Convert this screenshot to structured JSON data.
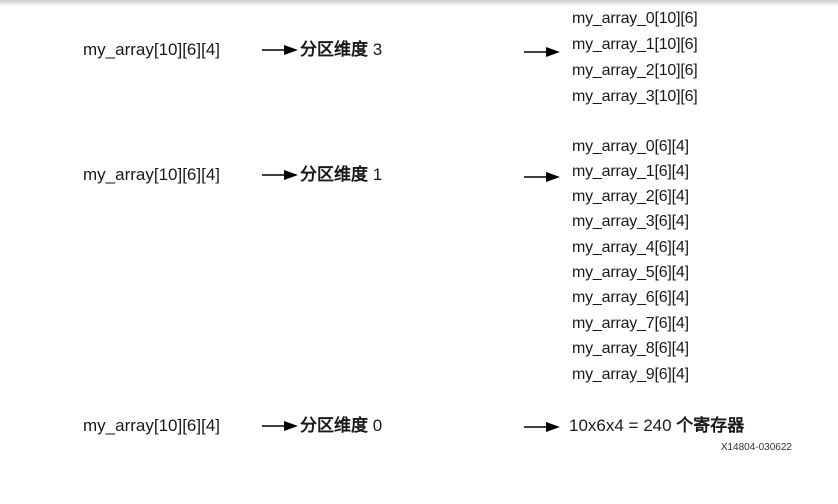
{
  "rows": [
    {
      "source": "my_array[10][6][4]",
      "label": "分区维度",
      "dim": "3",
      "outputs": [
        "my_array_0[10][6]",
        "my_array_1[10][6]",
        "my_array_2[10][6]",
        "my_array_3[10][6]"
      ]
    },
    {
      "source": "my_array[10][6][4]",
      "label": "分区维度",
      "dim": "1",
      "outputs": [
        "my_array_0[6][4]",
        "my_array_1[6][4]",
        "my_array_2[6][4]",
        "my_array_3[6][4]",
        "my_array_4[6][4]",
        "my_array_5[6][4]",
        "my_array_6[6][4]",
        "my_array_7[6][4]",
        "my_array_8[6][4]",
        "my_array_9[6][4]"
      ]
    },
    {
      "source": "my_array[10][6][4]",
      "label": "分区维度",
      "dim": "0",
      "result": "10x6x4 = 240",
      "result_unit": "个寄存器"
    }
  ],
  "figure_code": "X14804-030622"
}
